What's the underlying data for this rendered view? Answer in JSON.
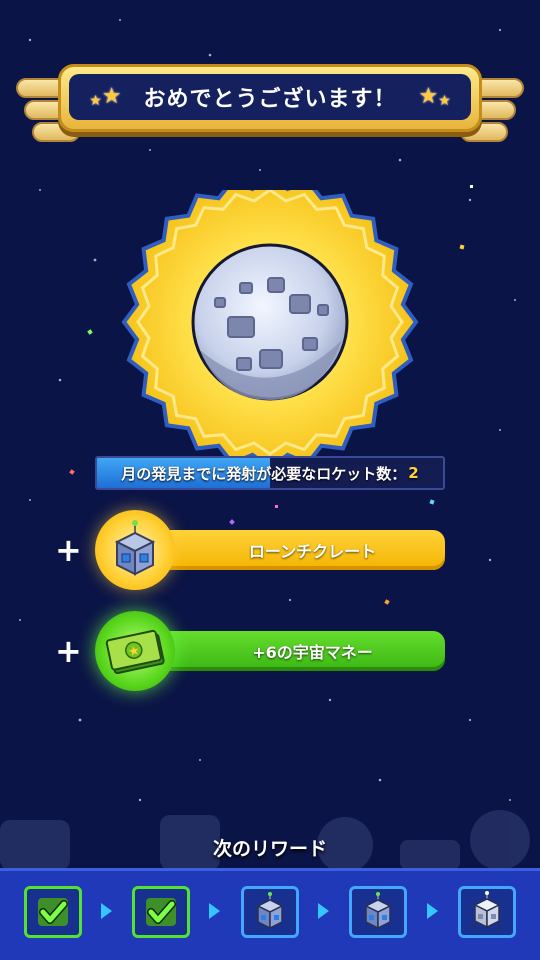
{
  "banner": {
    "title": "おめでとうございます！"
  },
  "moon_progress": {
    "label": "月の発見までに発射が必要なロケット数：",
    "remaining": "2",
    "fill_fraction": 0.5
  },
  "rewards": [
    {
      "label": "ローンチクレート",
      "icon": "launch-crate-icon",
      "color": "yellow"
    },
    {
      "label": "+6の宇宙マネー",
      "icon": "space-money-icon",
      "color": "green"
    }
  ],
  "next_rewards": {
    "title": "次のリワード",
    "slots": [
      {
        "icon": "check-icon",
        "state": "done"
      },
      {
        "icon": "check-icon",
        "state": "done"
      },
      {
        "icon": "launch-crate-icon",
        "state": "pending"
      },
      {
        "icon": "launch-crate-icon",
        "state": "pending"
      },
      {
        "icon": "silver-crate-icon",
        "state": "pending"
      }
    ]
  },
  "colors": {
    "background": "#0b1446",
    "gold": "#ffcd2e",
    "green": "#4fcf1c",
    "track_blue": "#1f39b8"
  }
}
